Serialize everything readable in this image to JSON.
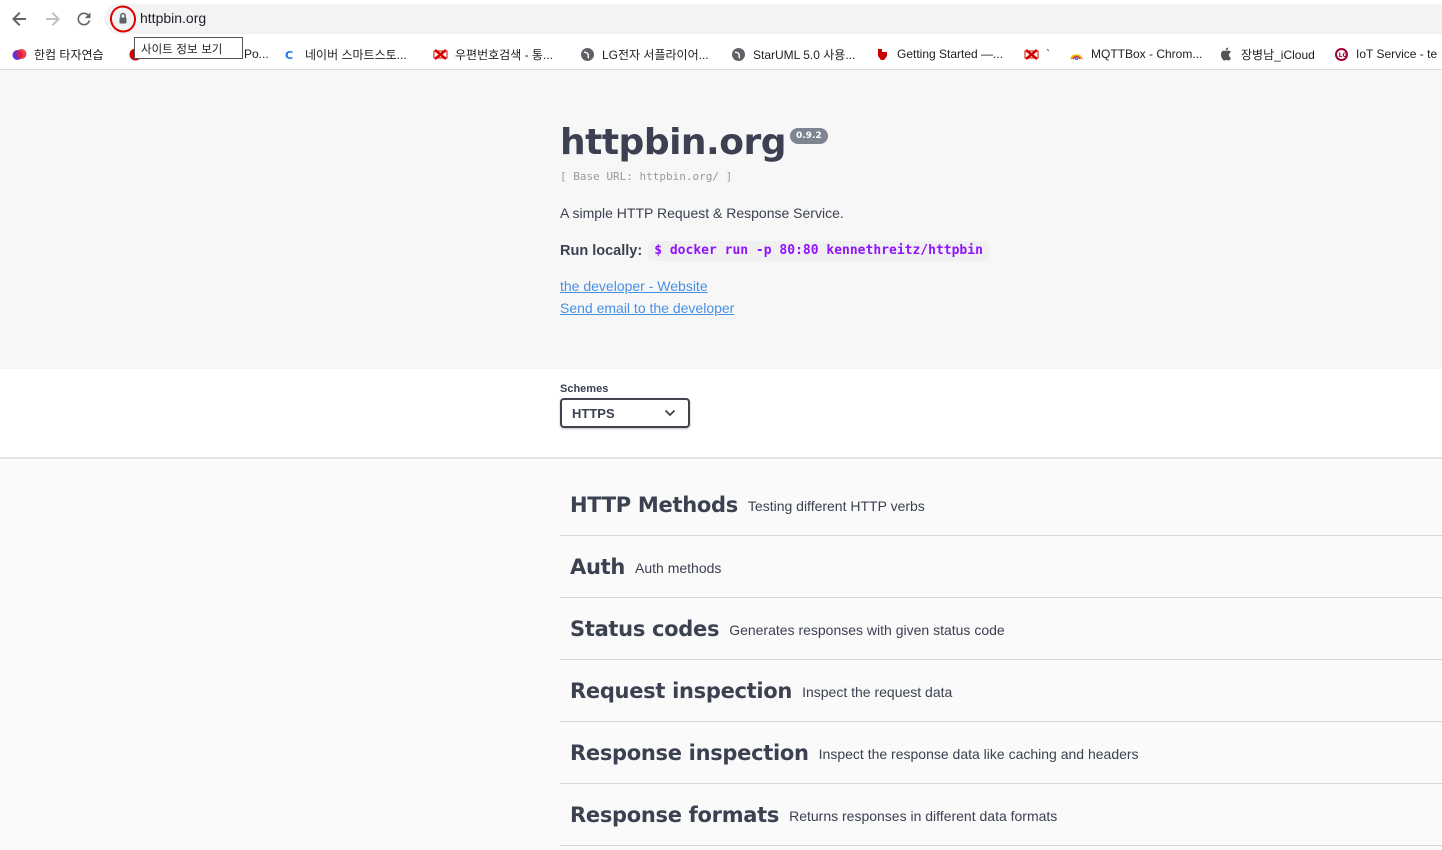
{
  "browser": {
    "url": "httpbin.org",
    "tooltip": "사이트 정보 보기",
    "bookmarks": [
      {
        "label": "한컴 타자연습",
        "icon": "hancom-icon"
      },
      {
        "label": "Po...",
        "icon": "red-circle-icon"
      },
      {
        "label": "네이버 스마트스토...",
        "icon": "naver-icon"
      },
      {
        "label": "우편번호검색 - 통...",
        "icon": "post-icon"
      },
      {
        "label": "LG전자 서플라이어...",
        "icon": "globe-icon"
      },
      {
        "label": "StarUML 5.0 사용...",
        "icon": "globe-icon"
      },
      {
        "label": "Getting Started —...",
        "icon": "ti-icon"
      },
      {
        "label": "`",
        "icon": "post-icon"
      },
      {
        "label": "MQTTBox - Chrom...",
        "icon": "mqttbox-icon"
      },
      {
        "label": "장병남_iCloud",
        "icon": "apple-icon"
      },
      {
        "label": "IoT Service - te",
        "icon": "lg-icon"
      }
    ]
  },
  "header": {
    "title": "httpbin.org",
    "version": "0.9.2",
    "base_url": "[ Base URL: httpbin.org/ ]",
    "description": "A simple HTTP Request & Response Service.",
    "run_label": "Run locally:",
    "run_command": "$ docker run -p 80:80 kennethreitz/httpbin",
    "link_website": "the developer - Website",
    "link_email": "Send email to the developer"
  },
  "schemes": {
    "label": "Schemes",
    "selected": "HTTPS"
  },
  "tags": [
    {
      "name": "HTTP Methods",
      "description": "Testing different HTTP verbs"
    },
    {
      "name": "Auth",
      "description": "Auth methods"
    },
    {
      "name": "Status codes",
      "description": "Generates responses with given status code"
    },
    {
      "name": "Request inspection",
      "description": "Inspect the request data"
    },
    {
      "name": "Response inspection",
      "description": "Inspect the response data like caching and headers"
    },
    {
      "name": "Response formats",
      "description": "Returns responses in different data formats"
    }
  ]
}
